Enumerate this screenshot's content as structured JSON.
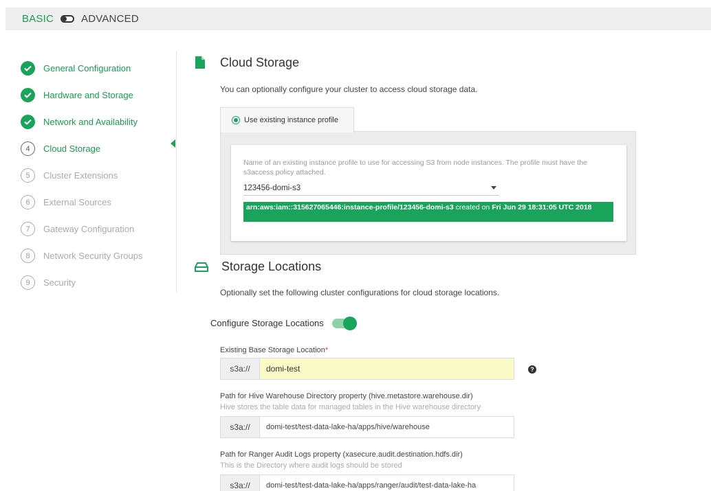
{
  "mode": {
    "basic": "BASIC",
    "advanced": "ADVANCED"
  },
  "steps": [
    {
      "label": "General Configuration",
      "state": "done"
    },
    {
      "label": "Hardware and Storage",
      "state": "done"
    },
    {
      "label": "Network and Availability",
      "state": "done"
    },
    {
      "label": "Cloud Storage",
      "number": "4",
      "state": "active"
    },
    {
      "label": "Cluster Extensions",
      "number": "5",
      "state": "pending"
    },
    {
      "label": "External Sources",
      "number": "6",
      "state": "pending"
    },
    {
      "label": "Gateway Configuration",
      "number": "7",
      "state": "pending"
    },
    {
      "label": "Network Security Groups",
      "number": "8",
      "state": "pending"
    },
    {
      "label": "Security",
      "number": "9",
      "state": "pending"
    }
  ],
  "cloud_storage": {
    "title": "Cloud Storage",
    "description": "You can optionally configure your cluster to access cloud storage data.",
    "tab_label": "Use existing instance profile",
    "help_text": "Name of an existing instance profile to use for accessing S3 from node instances. The profile must have the s3access policy attached.",
    "selected_profile": "123456-domi-s3",
    "arn": "arn:aws:iam::315627065446:instance-profile/123456-domi-s3",
    "created_on_label": " created on ",
    "created_on": "Fri Jun 29 18:31:05 UTC 2018"
  },
  "storage_locations": {
    "title": "Storage Locations",
    "description": "Optionally set the following cluster configurations for cloud storage locations.",
    "toggle_label": "Configure Storage Locations",
    "toggle_on": true,
    "base": {
      "label": "Existing Base Storage Location",
      "required_mark": "*",
      "prefix": "s3a://",
      "value": "domi-test"
    },
    "hive": {
      "label": "Path for Hive Warehouse Directory property (hive.metastore.warehouse.dir)",
      "help": "Hive stores the table data for managed tables in the Hive warehouse directory",
      "prefix": "s3a://",
      "value": "domi-test/test-data-lake-ha/apps/hive/warehouse"
    },
    "ranger": {
      "label": "Path for Ranger Audit Logs property (xasecure.audit.destination.hdfs.dir)",
      "help": "This is the Directory where audit logs should be stored",
      "prefix": "s3a://",
      "value": "domi-test/test-data-lake-ha/apps/ranger/audit/test-data-lake-ha"
    }
  },
  "colors": {
    "accent": "#1aa35a",
    "highlight_input": "#fbfbc8"
  }
}
